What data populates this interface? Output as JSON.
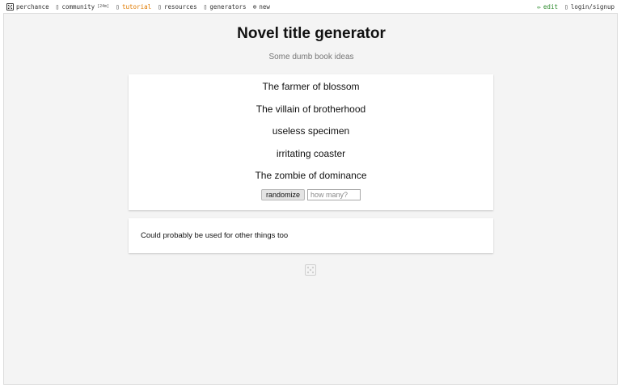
{
  "nav": {
    "left": [
      {
        "icon": "dice-icon",
        "label": "perchance"
      },
      {
        "icon": "chat-icon",
        "label": "community",
        "badge": "[24m]"
      },
      {
        "icon": "book-icon",
        "label": "tutorial"
      },
      {
        "icon": "file-icon",
        "label": "resources"
      },
      {
        "icon": "grid-icon",
        "label": "generators"
      },
      {
        "icon": "plus-circle-icon",
        "label": "new"
      }
    ],
    "right": [
      {
        "icon": "pencil-icon",
        "label": "edit"
      },
      {
        "icon": "user-icon",
        "label": "login/signup"
      }
    ]
  },
  "page": {
    "title": "Novel title generator",
    "subtitle": "Some dumb book ideas"
  },
  "output": {
    "results": [
      "The farmer of blossom",
      "The villain of brotherhood",
      "useless specimen",
      "irritating coaster",
      "The zombie of dominance"
    ],
    "randomize_label": "randomize",
    "count_value": "",
    "count_placeholder": "how many?"
  },
  "description": {
    "text": "Could probably be used for other things too"
  },
  "footer": {
    "icon": "dice-icon"
  },
  "colors": {
    "tutorial_accent": "#e07b00",
    "edit_accent": "#2e8b2e",
    "frame_background": "#f4f4f4",
    "card_background": "#ffffff"
  }
}
